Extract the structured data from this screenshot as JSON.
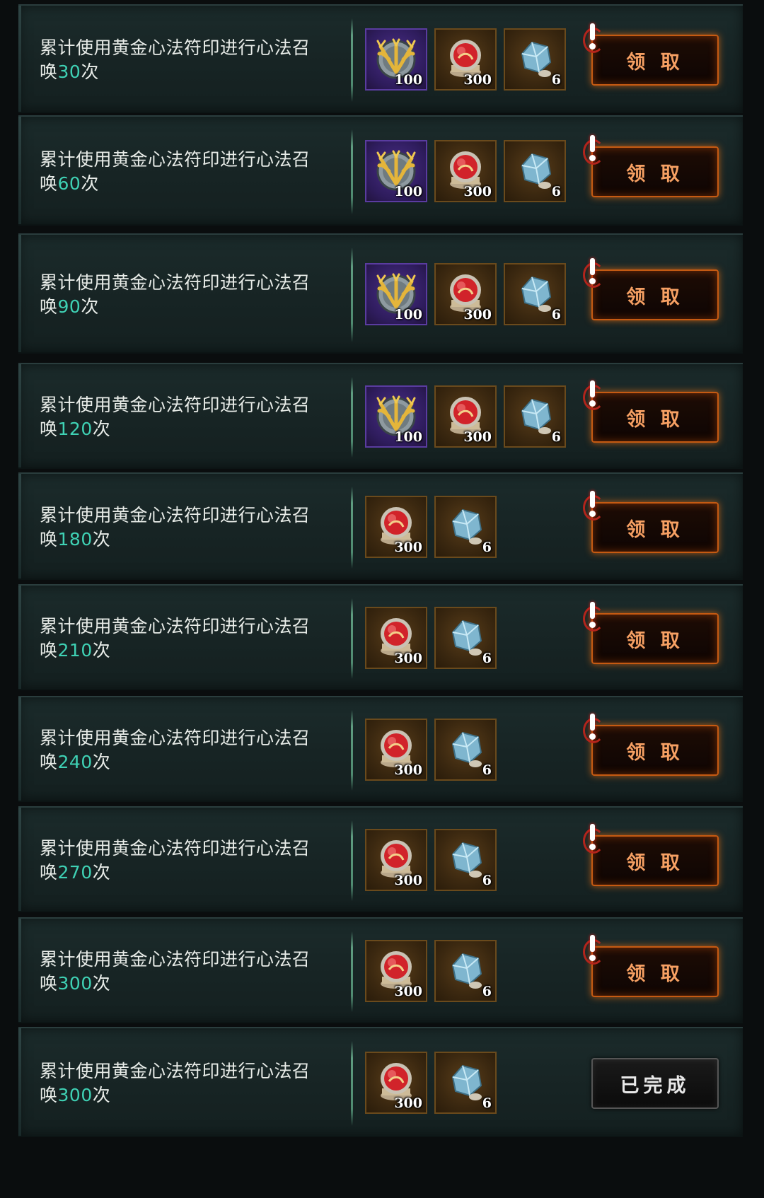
{
  "rows": [
    {
      "prefix": "累计使用黄金心法符印进行心法召",
      "suffix_a": "唤",
      "count": "30",
      "suffix_b": "次",
      "items": [
        {
          "kind": "gold-emblem",
          "qty": "100"
        },
        {
          "kind": "red-orb",
          "qty": "300"
        },
        {
          "kind": "blue-stone",
          "qty": "6"
        }
      ],
      "button": "领 取",
      "alert": true,
      "done": false
    },
    {
      "prefix": "累计使用黄金心法符印进行心法召",
      "suffix_a": "唤",
      "count": "60",
      "suffix_b": "次",
      "items": [
        {
          "kind": "gold-emblem",
          "qty": "100"
        },
        {
          "kind": "red-orb",
          "qty": "300"
        },
        {
          "kind": "blue-stone",
          "qty": "6"
        }
      ],
      "button": "领 取",
      "alert": true,
      "done": false
    },
    {
      "prefix": "累计使用黄金心法符印进行心法召",
      "suffix_a": "唤",
      "count": "90",
      "suffix_b": "次",
      "items": [
        {
          "kind": "gold-emblem",
          "qty": "100"
        },
        {
          "kind": "red-orb",
          "qty": "300"
        },
        {
          "kind": "blue-stone",
          "qty": "6"
        }
      ],
      "button": "领 取",
      "alert": true,
      "done": false
    },
    {
      "prefix": "累计使用黄金心法符印进行心法召",
      "suffix_a": "唤",
      "count": "120",
      "suffix_b": "次",
      "items": [
        {
          "kind": "gold-emblem",
          "qty": "100"
        },
        {
          "kind": "red-orb",
          "qty": "300"
        },
        {
          "kind": "blue-stone",
          "qty": "6"
        }
      ],
      "button": "领 取",
      "alert": true,
      "done": false
    },
    {
      "prefix": "累计使用黄金心法符印进行心法召",
      "suffix_a": "唤",
      "count": "180",
      "suffix_b": "次",
      "items": [
        {
          "kind": "red-orb",
          "qty": "300"
        },
        {
          "kind": "blue-stone",
          "qty": "6"
        }
      ],
      "button": "领 取",
      "alert": true,
      "done": false
    },
    {
      "prefix": "累计使用黄金心法符印进行心法召",
      "suffix_a": "唤",
      "count": "210",
      "suffix_b": "次",
      "items": [
        {
          "kind": "red-orb",
          "qty": "300"
        },
        {
          "kind": "blue-stone",
          "qty": "6"
        }
      ],
      "button": "领 取",
      "alert": true,
      "done": false
    },
    {
      "prefix": "累计使用黄金心法符印进行心法召",
      "suffix_a": "唤",
      "count": "240",
      "suffix_b": "次",
      "items": [
        {
          "kind": "red-orb",
          "qty": "300"
        },
        {
          "kind": "blue-stone",
          "qty": "6"
        }
      ],
      "button": "领 取",
      "alert": true,
      "done": false
    },
    {
      "prefix": "累计使用黄金心法符印进行心法召",
      "suffix_a": "唤",
      "count": "270",
      "suffix_b": "次",
      "items": [
        {
          "kind": "red-orb",
          "qty": "300"
        },
        {
          "kind": "blue-stone",
          "qty": "6"
        }
      ],
      "button": "领 取",
      "alert": true,
      "done": false
    },
    {
      "prefix": "累计使用黄金心法符印进行心法召",
      "suffix_a": "唤",
      "count": "300",
      "suffix_b": "次",
      "items": [
        {
          "kind": "red-orb",
          "qty": "300"
        },
        {
          "kind": "blue-stone",
          "qty": "6"
        }
      ],
      "button": "领 取",
      "alert": true,
      "done": false
    },
    {
      "prefix": "累计使用黄金心法符印进行心法召",
      "suffix_a": "唤",
      "count": "300",
      "suffix_b": "次",
      "items": [
        {
          "kind": "red-orb",
          "qty": "300"
        },
        {
          "kind": "blue-stone",
          "qty": "6"
        }
      ],
      "button": "已完成",
      "alert": false,
      "done": true
    }
  ],
  "colors": {
    "count_accent": "#3fd1b4",
    "claim_text": "#f6a063",
    "claim_glow": "#c55a12",
    "purple_slot": "#4a2e88",
    "brown_slot": "#5a3e1a"
  }
}
